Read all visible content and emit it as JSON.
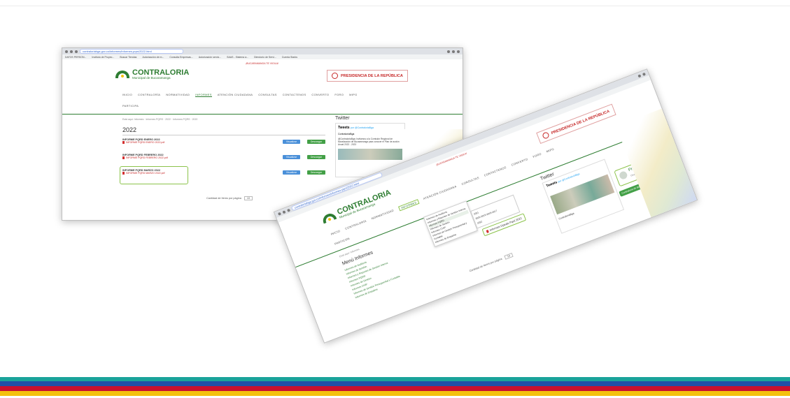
{
  "colors": {
    "brand_green": "#2e7d32",
    "stripe_teal": "#1aa39a",
    "stripe_blue": "#1f4fa8",
    "stripe_red": "#c8102e",
    "stripe_yellow": "#f4c20d"
  },
  "shot1": {
    "url": "contraloriabga.gov.co/informes/informes-pqrs/2022.html",
    "bookmarks": [
      "DATOS PERSON...",
      "Instituto de Proyec...",
      "Buscar Tiendas",
      "Autorización de m...",
      "Consulta Empresas...",
      "Autorización servic...",
      "SAAS - Sistema a...",
      "Directorio de Servi...",
      "Cuenta Starks"
    ],
    "logo_title": "CONTRALORIA",
    "logo_sub": "Municipal de Bucaramanga",
    "vigila": "¡BUCARAMANGA TE VIGILA!",
    "presidencia": "PRESIDENCIA DE LA REPÚBLICA",
    "menu": [
      "INICIO",
      "CONTRALORÍA",
      "NORMATIVIDAD",
      "INFORMES",
      "ATENCIÓN CIUDADANA",
      "CONSULTAS",
      "CONTACTENOS",
      "CONVERTO",
      "FORO",
      "MIPG"
    ],
    "menu_row2": "PARTICIPA",
    "breadcrumb": "Está aquí: Informes · Informes PQRS · 2022 · Informes PQRS · 2022",
    "year": "2022",
    "reports": [
      {
        "title": "INFORME PQRD ENERO 2022",
        "file": "INFORME PQRD ENERO 2022.pdf"
      },
      {
        "title": "INFORME PQRD FEBRERO 2022",
        "file": "INFORME PQRD FEBRERO 2022.pdf"
      },
      {
        "title": "INFORME PQRD MARZO 2022",
        "file": "INFORME PQRD MARZO 2022.pdf"
      }
    ],
    "btn_view": "Visualizar",
    "btn_download": "Descargar",
    "pager": "Cantidad de Items por página",
    "pager_value": "10",
    "twitter_title": "Twitter",
    "tweets_label": "Tweets",
    "tweets_by": "por @ContraloriaBga",
    "tweet_handle": "ContraloriaBga",
    "tweet_text": "@ContraloriaBga: Invitamos a la Comisión Regional de Moralización de Bucaramanga para conocer el Plan de acción Anual 2022 - 2023"
  },
  "shot2": {
    "url": "contraloriabga.gov.co/informes/informes-pqrs/2022.html",
    "vigila": "¡BUCARAMANGA TE VIGILA!",
    "presidencia": "PRESIDENCIA DE LA REPÚBLICA",
    "logo_title": "CONTRALORIA",
    "logo_sub": "Municipal de Bucaramanga",
    "menu": [
      "INICIO",
      "CONTRALORÍA",
      "NORMATIVIDAD",
      "INFORMES",
      "ATENCIÓN CIUDADANA",
      "CONSULTAS",
      "CONTACTENOS",
      "CONVERTO",
      "FORO",
      "MIPG"
    ],
    "menu_row2": "PARTICIPA",
    "dropdown": [
      "Informes de Auditoría",
      "Informes y Reportes de Gestión Interna",
      "Informes PQRD",
      "Informes de Gestión",
      "Informes CHIP",
      "Informes de Gestión Presupuestal y Contable",
      "Informes de Empalme"
    ],
    "submenu": [
      "2021",
      "2020-2019-2018-2017",
      "2022"
    ],
    "highlight_item": "Informes Opeals Pqrd 2022",
    "breadcrumb": "Está aquí: Informes",
    "side_title": "Menú Informes",
    "side_items": [
      "Informes de Auditoría",
      "Informes de Gestión",
      "Informes y Reportes de Gestión Interna",
      "Informes PQRD",
      "Informes de Gestión",
      "Informes CHIP",
      "Informes de Gestión Presupuestal y Contable",
      "Informes de Empalme"
    ],
    "pager": "Cantidad de Items por página",
    "pager_value": "10",
    "twitter_title": "Twitter",
    "tweets_label": "Tweets",
    "tweets_by": "por @ContraloriaBga",
    "chat_title": "Preguntas?",
    "chat_sub": "Chat con nosotros",
    "chat_bar": "Contraloría de Bmanga - Estamos aquí ✉",
    "contraloriabga": "ContraloriaBga"
  }
}
